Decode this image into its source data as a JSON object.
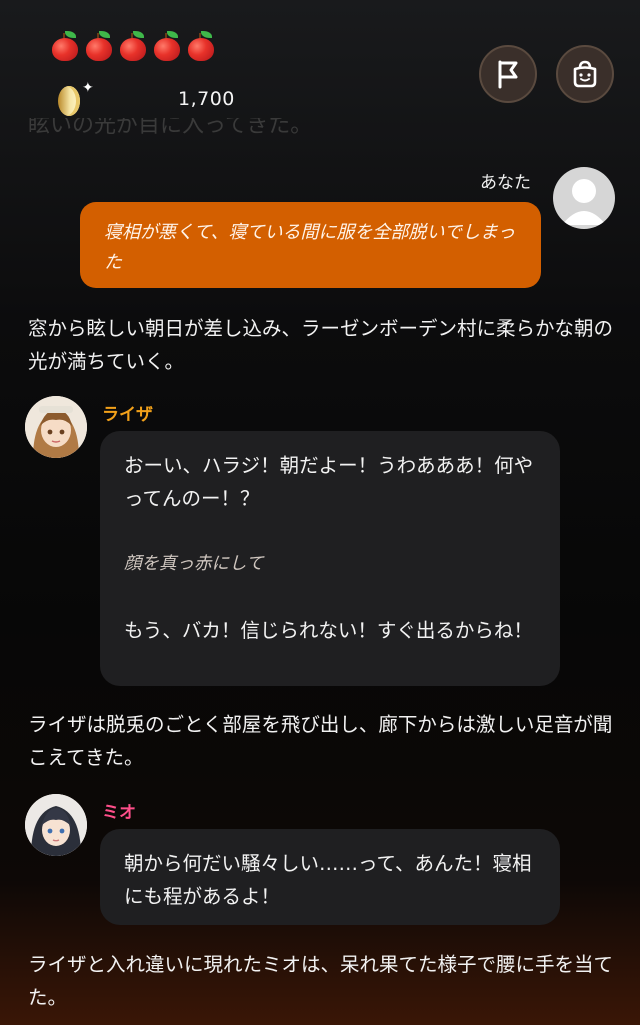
{
  "hud": {
    "apple_count": 5,
    "coin_amount": "1,700"
  },
  "ghost_line": "眩いの光が目に入ってきた。",
  "user": {
    "name": "あなた",
    "message": "寝相が悪くて、寝ている間に服を全部脱いでしまった"
  },
  "narration": {
    "n1": "窓から眩しい朝日が差し込み、ラーゼンボーデン村に柔らかな朝の光が満ちていく。",
    "n2": "ライザは脱兎のごとく部屋を飛び出し、廊下からは激しい足音が聞こえてきた。",
    "n3": "ライザと入れ違いに現れたミオは、呆れ果てた様子で腰に手を当てた。"
  },
  "characters": [
    {
      "name": "ライザ",
      "name_color": "#f2a11a",
      "line1": "おーい、ハラジ！朝だよー！うわあああ！何やってんのー！？",
      "action": "顔を真っ赤にして",
      "line2": "もう、バカ！信じられない！すぐ出るからね！"
    },
    {
      "name": "ミオ",
      "name_color": "#ff4f8a",
      "line1": "朝から何だい騒々しい……って、あんた！寝相にも程があるよ！"
    }
  ],
  "colors": {
    "user_bubble": "#d35f00",
    "char_bubble": "#1f1f21",
    "hud_button": "#3a2f2a"
  }
}
